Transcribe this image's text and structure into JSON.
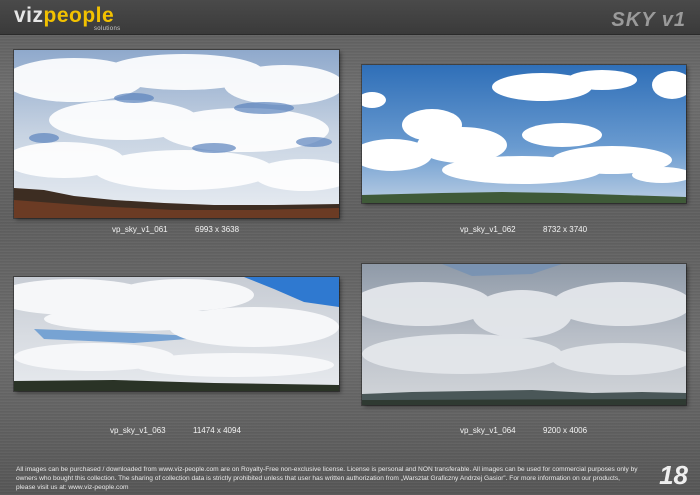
{
  "header": {
    "logo_part1": "viz",
    "logo_part2": "people",
    "logo_sub": "solutions",
    "title": "SKY v1",
    "accent_color": "#f2c100"
  },
  "images": [
    {
      "name": "vp_sky_v1_061",
      "resolution": "6993 x 3638"
    },
    {
      "name": "vp_sky_v1_062",
      "resolution": "8732 x 3740"
    },
    {
      "name": "vp_sky_v1_063",
      "resolution": "11474 x 4094"
    },
    {
      "name": "vp_sky_v1_064",
      "resolution": "9200 x 4006"
    }
  ],
  "footer": {
    "license": "All images can be purchased / downloaded from www.viz-people.com are on Royalty-Free non-exclusive license. License is personal and NON transferable. All images can be used for commercial purposes only by owners who bought this collection. The sharing of collection data is strictly prohibited unless that user has written authorization from „Warsztat Graficzny Andrzej Gasior”. For more information on our products, please visit us at: www.viz-people.com",
    "page_number": "18"
  }
}
